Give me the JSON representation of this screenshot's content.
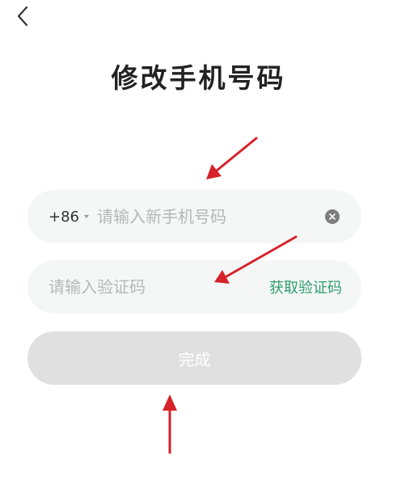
{
  "header": {
    "back_icon": "chevron-left-icon",
    "title": "修改手机号码"
  },
  "phone_field": {
    "country_code": "+86",
    "placeholder": "请输入新手机号码",
    "value": "",
    "clear_icon": "clear-circle-icon"
  },
  "code_field": {
    "placeholder": "请输入验证码",
    "value": "",
    "get_code_label": "获取验证码"
  },
  "submit": {
    "label": "完成",
    "enabled": false
  },
  "colors": {
    "accent": "#2f9e6e",
    "annotation_arrow": "#d6222a",
    "field_bg": "#f4f7f6",
    "disabled_button": "#e0e0e0"
  }
}
